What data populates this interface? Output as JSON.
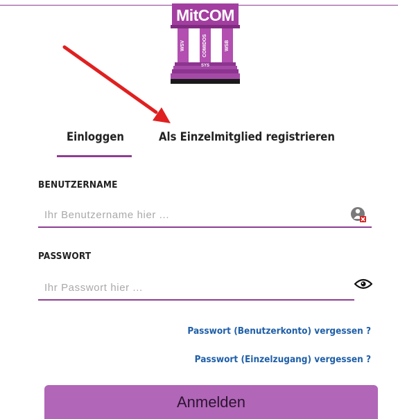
{
  "logo": {
    "title": "MitCOM",
    "pillars": [
      "WSV",
      "COMIDOS",
      "WSB"
    ],
    "steps_text": "SYS"
  },
  "tabs": [
    {
      "label": "Einloggen",
      "active": true
    },
    {
      "label": "Als Einzelmitglied registrieren",
      "active": false
    }
  ],
  "username": {
    "label": "BENUTZERNAME",
    "placeholder": "Ihr Benutzername hier ...",
    "value": "",
    "icon": "user-clear-icon"
  },
  "password": {
    "label": "PASSWORT",
    "placeholder": "Ihr Passwort hier ...",
    "value": "",
    "icon": "eye-icon"
  },
  "links": {
    "forgot_account": "Passwort (Benutzerkonto) vergessen ?",
    "forgot_single": "Passwort (Einzelzugang) vergessen ?"
  },
  "submit_label": "Anmelden",
  "colors": {
    "accent": "#8e3d92",
    "button": "#b266b8",
    "link": "#1f5fa8",
    "arrow": "#e02020"
  }
}
